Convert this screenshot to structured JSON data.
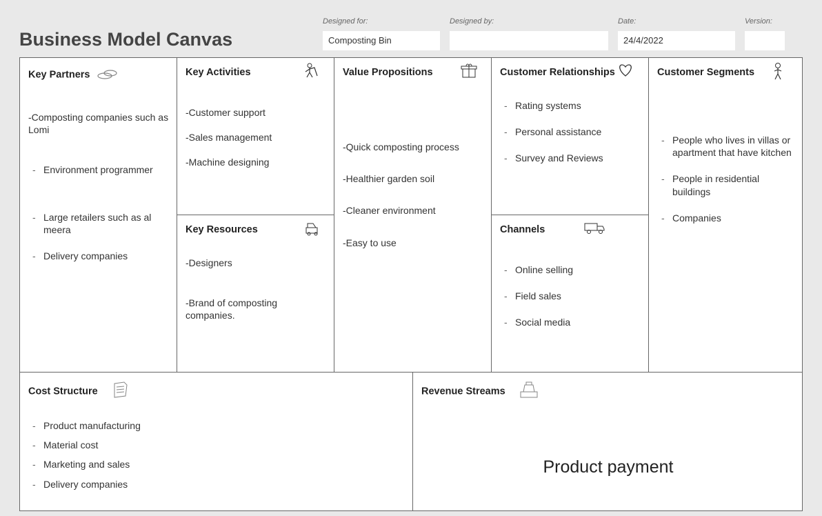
{
  "header": {
    "title": "Business Model Canvas",
    "designed_for_label": "Designed for:",
    "designed_for": "Composting Bin",
    "designed_by_label": "Designed by:",
    "designed_by": "",
    "date_label": "Date:",
    "date": "24/4/2022",
    "version_label": "Version:",
    "version": ""
  },
  "cells": {
    "key_partners": {
      "title": "Key Partners",
      "lines": [
        "-Composting companies such as Lomi"
      ],
      "bullets": [
        "Environment programmer",
        "Large retailers such as al meera",
        "Delivery companies"
      ]
    },
    "key_activities": {
      "title": "Key Activities",
      "lines": [
        "-Customer support",
        "-Sales management",
        "-Machine designing"
      ]
    },
    "key_resources": {
      "title": "Key Resources",
      "lines": [
        "-Designers",
        "-Brand of composting companies."
      ]
    },
    "value_propositions": {
      "title": "Value Propositions",
      "lines": [
        "-Quick composting process",
        "-Healthier garden soil",
        "-Cleaner environment",
        "-Easy to use"
      ]
    },
    "customer_relationships": {
      "title": "Customer Relationships",
      "bullets": [
        "Rating systems",
        "Personal assistance",
        "Survey and Reviews"
      ]
    },
    "channels": {
      "title": "Channels",
      "bullets": [
        "Online selling",
        "Field sales",
        "Social media"
      ]
    },
    "customer_segments": {
      "title": "Customer Segments",
      "bullets": [
        "People who lives in villas or apartment that have kitchen",
        "People in residential buildings",
        "Companies"
      ]
    },
    "cost_structure": {
      "title": "Cost Structure",
      "bullets": [
        "Product manufacturing",
        "Material cost",
        "Marketing and sales",
        "Delivery companies"
      ]
    },
    "revenue_streams": {
      "title": "Revenue Streams",
      "big": "Product payment"
    }
  }
}
